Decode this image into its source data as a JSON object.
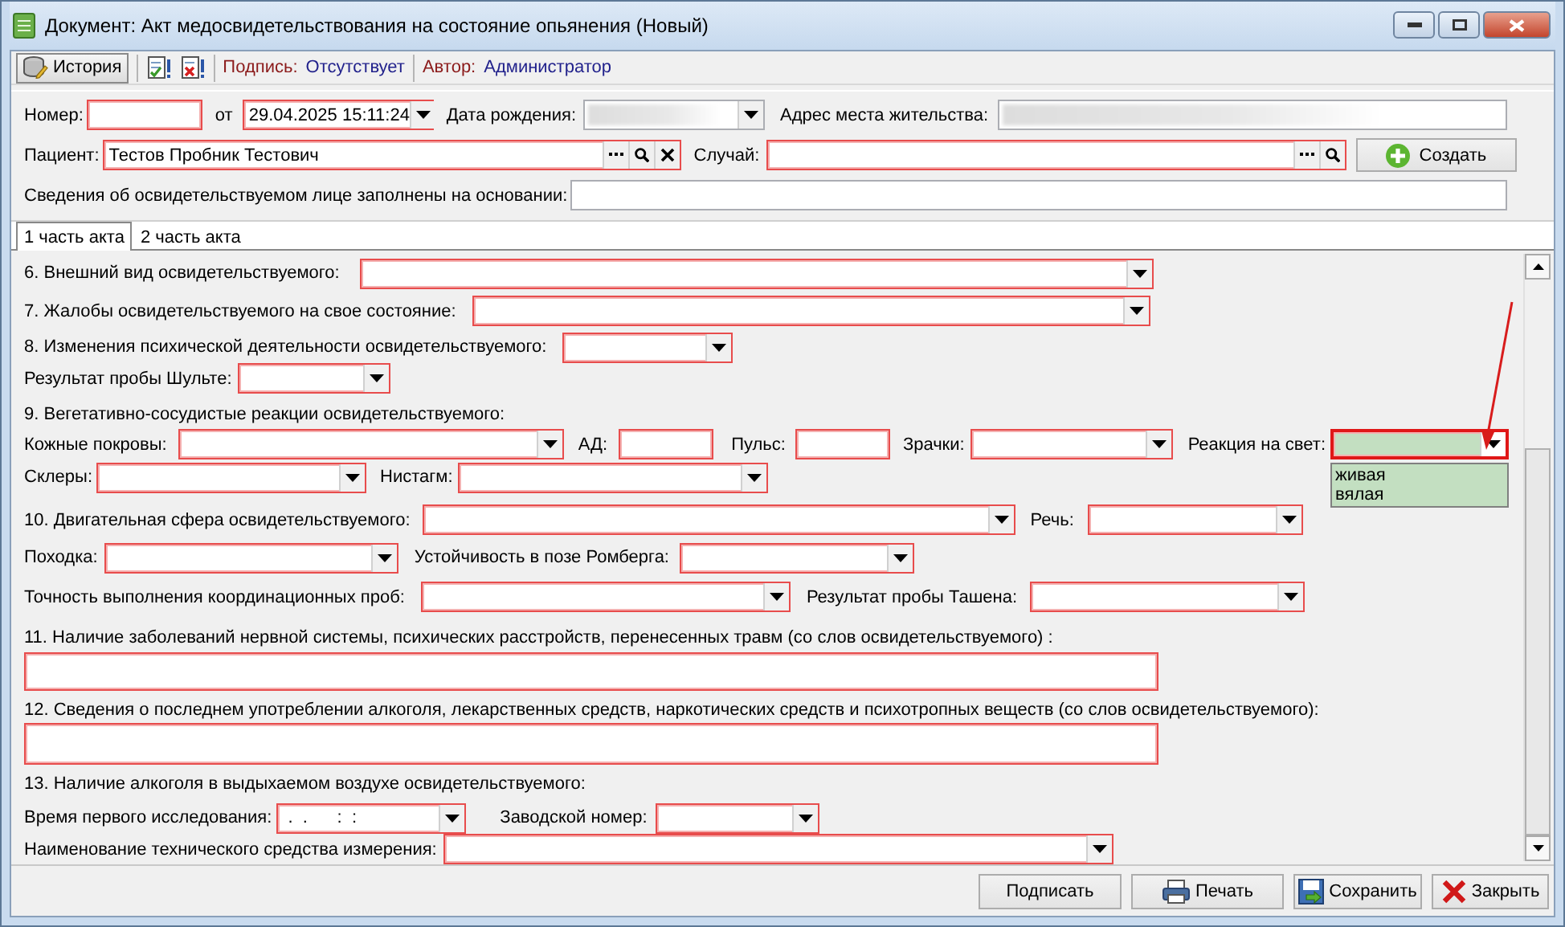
{
  "window": {
    "title": "Документ: Акт медосвидетельствования на состояние опьянения (Новый)"
  },
  "toolbar": {
    "history_button": "История",
    "signature": {
      "label": "Подпись:",
      "value": "Отсутствует"
    },
    "author": {
      "label": "Автор:",
      "value": "Администратор"
    }
  },
  "header": {
    "rows": [
      {
        "items": [
          {
            "kind": "label",
            "text": "Номер:"
          },
          {
            "kind": "field",
            "required": true
          },
          {
            "kind": "label",
            "text": "от"
          },
          {
            "kind": "combo",
            "required": true,
            "value": "29.04.2025 15:11:24"
          },
          {
            "kind": "label",
            "text": "Дата рождения:"
          },
          {
            "kind": "combo",
            "required": false,
            "redacted": true
          },
          {
            "kind": "label",
            "text": "Адрес места жительства:"
          },
          {
            "kind": "field",
            "required": false,
            "redacted": true
          }
        ]
      },
      {
        "items": [
          {
            "kind": "label",
            "text": "Пациент:"
          },
          {
            "kind": "lookup",
            "required": true,
            "value": "Тестов Пробник Тестович",
            "clear_button": true
          },
          {
            "kind": "label",
            "text": "Случай:"
          },
          {
            "kind": "lookup",
            "required": true,
            "clear_button": false
          },
          {
            "kind": "button",
            "label": "Создать"
          }
        ]
      },
      {
        "items": [
          {
            "kind": "label",
            "text": "Сведения об освидетельствуемом лице заполнены на основании:"
          },
          {
            "kind": "field",
            "required": false
          }
        ]
      }
    ]
  },
  "tabs": [
    {
      "label": "1 часть акта",
      "selected": true
    },
    {
      "label": "2 часть акта",
      "selected": false
    }
  ],
  "form_rows": [
    {
      "items": [
        {
          "kind": "label",
          "text": "6. Внешний вид освидетельствуемого:"
        },
        {
          "kind": "combo",
          "required": true
        }
      ]
    },
    {
      "items": [
        {
          "kind": "label",
          "text": "7. Жалобы освидетельствуемого на свое состояние:"
        },
        {
          "kind": "combo",
          "required": true
        }
      ]
    },
    {
      "items": [
        {
          "kind": "label",
          "text": "8. Изменения психической деятельности освидетельствуемого:"
        },
        {
          "kind": "combo",
          "required": true
        }
      ]
    },
    {
      "items": [
        {
          "kind": "label",
          "text": "Результат пробы Шульте:"
        },
        {
          "kind": "combo",
          "required": true
        }
      ]
    },
    {
      "items": [
        {
          "kind": "label",
          "text": "9. Вегетативно-сосудистые реакции освидетельствуемого:"
        }
      ]
    },
    {
      "items": [
        {
          "kind": "label",
          "text": "Кожные покровы:"
        },
        {
          "kind": "combo",
          "required": true
        },
        {
          "kind": "label",
          "text": "АД:"
        },
        {
          "kind": "field",
          "required": true
        },
        {
          "kind": "label",
          "text": "Пульс:"
        },
        {
          "kind": "field",
          "required": true
        },
        {
          "kind": "label",
          "text": "Зрачки:"
        },
        {
          "kind": "combo",
          "required": true
        },
        {
          "kind": "label",
          "text": "Реакция на свет:"
        },
        {
          "kind": "combo",
          "required": true,
          "open": true,
          "options": [
            "живая",
            "вялая"
          ]
        }
      ]
    },
    {
      "items": [
        {
          "kind": "label",
          "text": "Склеры:"
        },
        {
          "kind": "combo",
          "required": true
        },
        {
          "kind": "label",
          "text": "Нистагм:"
        },
        {
          "kind": "combo",
          "required": true
        }
      ]
    },
    {
      "items": [
        {
          "kind": "label",
          "text": "10. Двигательная сфера освидетельствуемого:"
        },
        {
          "kind": "combo",
          "required": true
        },
        {
          "kind": "label",
          "text": "Речь:"
        },
        {
          "kind": "combo",
          "required": true
        }
      ]
    },
    {
      "items": [
        {
          "kind": "label",
          "text": "Походка:"
        },
        {
          "kind": "combo",
          "required": true
        },
        {
          "kind": "label",
          "text": "Устойчивость в позе Ромберга:"
        },
        {
          "kind": "combo",
          "required": true
        }
      ]
    },
    {
      "items": [
        {
          "kind": "label",
          "text": "Точность выполнения координационных проб:"
        },
        {
          "kind": "combo",
          "required": true
        },
        {
          "kind": "label",
          "text": "Результат пробы Ташена:"
        },
        {
          "kind": "combo",
          "required": true
        }
      ]
    },
    {
      "items": [
        {
          "kind": "label",
          "text": "11. Наличие заболеваний нервной системы, психических расстройств, перенесенных травм (со слов освидетельствуемого) :"
        }
      ]
    },
    {
      "items": [
        {
          "kind": "memo",
          "required": true
        }
      ]
    },
    {
      "items": [
        {
          "kind": "label",
          "text": "12. Сведения о последнем употреблении алкоголя, лекарственных средств, наркотических средств и психотропных веществ (со слов освидетельствуемого):"
        }
      ]
    },
    {
      "items": [
        {
          "kind": "memo",
          "required": true
        }
      ]
    },
    {
      "items": [
        {
          "kind": "label",
          "text": "13. Наличие алкоголя в выдыхаемом воздухе освидетельствуемого:"
        }
      ]
    },
    {
      "items": [
        {
          "kind": "label",
          "text": "Время первого исследования:"
        },
        {
          "kind": "combo",
          "required": true,
          "value": " .  .      :  :"
        },
        {
          "kind": "label",
          "text": "Заводской номер:"
        },
        {
          "kind": "combo",
          "required": true
        }
      ]
    },
    {
      "items": [
        {
          "kind": "label",
          "text": "Наименование технического средства измерения:"
        },
        {
          "kind": "combo",
          "required": true
        }
      ]
    }
  ],
  "buttons": [
    {
      "kind": "sign",
      "label": "Подписать"
    },
    {
      "kind": "print",
      "label": "Печать"
    },
    {
      "kind": "save",
      "label": "Сохранить"
    },
    {
      "kind": "close",
      "label": "Закрыть"
    }
  ]
}
